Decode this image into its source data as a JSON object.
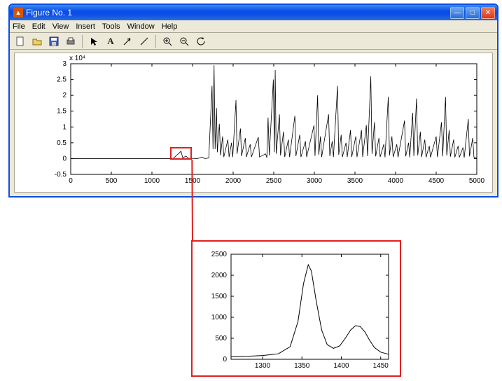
{
  "titlebar": {
    "title": "Figure No. 1"
  },
  "menu": {
    "file": "File",
    "edit": "Edit",
    "view": "View",
    "insert": "Insert",
    "tools": "Tools",
    "window": "Window",
    "help": "Help"
  },
  "toolbar": {
    "new": "□",
    "open": "📂",
    "save": "💾",
    "print": "🖨",
    "arrow": "↖",
    "textA": "A",
    "line": "╱",
    "zoomin": "⊕",
    "zoomout": "⊖",
    "rotate": "↻"
  },
  "chart_data": {
    "type": "line",
    "title": "",
    "xlabel": "",
    "ylabel": "",
    "exponent": "x 10⁴",
    "xlim": [
      0,
      5000
    ],
    "ylim": [
      -0.5,
      3
    ],
    "xticks": [
      0,
      500,
      1000,
      1500,
      2000,
      2500,
      3000,
      3500,
      4000,
      4500,
      5000
    ],
    "yticks": [
      -0.5,
      0,
      0.5,
      1,
      1.5,
      2,
      2.5,
      3
    ],
    "ytick_labels": [
      "-0.5",
      "0",
      "0.5",
      "1",
      "1.5",
      "2",
      "2.5",
      "3"
    ],
    "callout_region": {
      "xmin": 1250,
      "xmax": 1520,
      "ymin": -0.1,
      "ymax": 0.3
    },
    "inset": {
      "xlim": [
        1260,
        1460
      ],
      "ylim": [
        0,
        2500
      ],
      "xticks": [
        1300,
        1350,
        1400,
        1450
      ],
      "yticks": [
        0,
        500,
        1000,
        1500,
        2000,
        2500
      ],
      "xtick_labels": [
        "1300",
        "1350",
        "1400",
        "1450"
      ],
      "ytick_labels": [
        "0",
        "500",
        "1000",
        "1500",
        "2000",
        "2500"
      ],
      "series": [
        {
          "x": 1260,
          "y": 60
        },
        {
          "x": 1280,
          "y": 70
        },
        {
          "x": 1300,
          "y": 90
        },
        {
          "x": 1320,
          "y": 130
        },
        {
          "x": 1335,
          "y": 300
        },
        {
          "x": 1345,
          "y": 900
        },
        {
          "x": 1352,
          "y": 1800
        },
        {
          "x": 1358,
          "y": 2250
        },
        {
          "x": 1362,
          "y": 2100
        },
        {
          "x": 1368,
          "y": 1400
        },
        {
          "x": 1375,
          "y": 700
        },
        {
          "x": 1382,
          "y": 350
        },
        {
          "x": 1390,
          "y": 260
        },
        {
          "x": 1398,
          "y": 320
        },
        {
          "x": 1405,
          "y": 500
        },
        {
          "x": 1412,
          "y": 700
        },
        {
          "x": 1418,
          "y": 800
        },
        {
          "x": 1424,
          "y": 780
        },
        {
          "x": 1430,
          "y": 650
        },
        {
          "x": 1436,
          "y": 450
        },
        {
          "x": 1442,
          "y": 280
        },
        {
          "x": 1450,
          "y": 170
        },
        {
          "x": 1460,
          "y": 120
        }
      ]
    },
    "main_series": [
      {
        "x": 0,
        "y": 0.0
      },
      {
        "x": 1200,
        "y": 0.0
      },
      {
        "x": 1260,
        "y": 0.0
      },
      {
        "x": 1358,
        "y": 0.23
      },
      {
        "x": 1380,
        "y": 0.02
      },
      {
        "x": 1418,
        "y": 0.08
      },
      {
        "x": 1450,
        "y": 0.01
      },
      {
        "x": 1560,
        "y": 0.0
      },
      {
        "x": 1620,
        "y": 0.05
      },
      {
        "x": 1650,
        "y": 0.0
      },
      {
        "x": 1700,
        "y": 0.02
      },
      {
        "x": 1740,
        "y": 2.3
      },
      {
        "x": 1752,
        "y": 0.3
      },
      {
        "x": 1765,
        "y": 2.95
      },
      {
        "x": 1778,
        "y": 0.3
      },
      {
        "x": 1795,
        "y": 1.6
      },
      {
        "x": 1805,
        "y": 0.2
      },
      {
        "x": 1830,
        "y": 1.1
      },
      {
        "x": 1845,
        "y": 0.1
      },
      {
        "x": 1870,
        "y": 0.7
      },
      {
        "x": 1885,
        "y": 0.05
      },
      {
        "x": 1935,
        "y": 0.6
      },
      {
        "x": 1950,
        "y": 0.05
      },
      {
        "x": 1980,
        "y": 0.5
      },
      {
        "x": 1995,
        "y": 0.05
      },
      {
        "x": 2035,
        "y": 1.85
      },
      {
        "x": 2048,
        "y": 0.15
      },
      {
        "x": 2090,
        "y": 0.95
      },
      {
        "x": 2103,
        "y": 0.08
      },
      {
        "x": 2150,
        "y": 0.65
      },
      {
        "x": 2163,
        "y": 0.05
      },
      {
        "x": 2210,
        "y": 0.45
      },
      {
        "x": 2225,
        "y": 0.05
      },
      {
        "x": 2310,
        "y": 0.68
      },
      {
        "x": 2325,
        "y": 0.05
      },
      {
        "x": 2400,
        "y": 0.15
      },
      {
        "x": 2415,
        "y": 0.03
      },
      {
        "x": 2430,
        "y": 1.3
      },
      {
        "x": 2445,
        "y": 0.1
      },
      {
        "x": 2495,
        "y": 2.5
      },
      {
        "x": 2508,
        "y": 0.2
      },
      {
        "x": 2518,
        "y": 2.8
      },
      {
        "x": 2530,
        "y": 0.15
      },
      {
        "x": 2570,
        "y": 1.4
      },
      {
        "x": 2583,
        "y": 0.1
      },
      {
        "x": 2620,
        "y": 0.85
      },
      {
        "x": 2635,
        "y": 0.05
      },
      {
        "x": 2680,
        "y": 0.6
      },
      {
        "x": 2695,
        "y": 0.05
      },
      {
        "x": 2760,
        "y": 1.35
      },
      {
        "x": 2773,
        "y": 0.08
      },
      {
        "x": 2820,
        "y": 0.75
      },
      {
        "x": 2835,
        "y": 0.05
      },
      {
        "x": 2890,
        "y": 0.55
      },
      {
        "x": 2905,
        "y": 0.05
      },
      {
        "x": 2995,
        "y": 1.05
      },
      {
        "x": 3008,
        "y": 0.08
      },
      {
        "x": 3040,
        "y": 2.0
      },
      {
        "x": 3055,
        "y": 0.12
      },
      {
        "x": 3075,
        "y": 0.7
      },
      {
        "x": 3090,
        "y": 0.05
      },
      {
        "x": 3175,
        "y": 1.4
      },
      {
        "x": 3190,
        "y": 0.08
      },
      {
        "x": 3220,
        "y": 0.55
      },
      {
        "x": 3235,
        "y": 0.05
      },
      {
        "x": 3285,
        "y": 2.3
      },
      {
        "x": 3300,
        "y": 0.12
      },
      {
        "x": 3330,
        "y": 0.75
      },
      {
        "x": 3345,
        "y": 0.05
      },
      {
        "x": 3390,
        "y": 0.5
      },
      {
        "x": 3405,
        "y": 0.05
      },
      {
        "x": 3445,
        "y": 0.9
      },
      {
        "x": 3460,
        "y": 0.05
      },
      {
        "x": 3510,
        "y": 0.7
      },
      {
        "x": 3525,
        "y": 0.05
      },
      {
        "x": 3580,
        "y": 0.9
      },
      {
        "x": 3595,
        "y": 0.05
      },
      {
        "x": 3640,
        "y": 1.06
      },
      {
        "x": 3655,
        "y": 0.08
      },
      {
        "x": 3695,
        "y": 2.6
      },
      {
        "x": 3710,
        "y": 0.15
      },
      {
        "x": 3740,
        "y": 1.15
      },
      {
        "x": 3755,
        "y": 0.07
      },
      {
        "x": 3795,
        "y": 0.65
      },
      {
        "x": 3810,
        "y": 0.05
      },
      {
        "x": 3855,
        "y": 0.45
      },
      {
        "x": 3870,
        "y": 0.04
      },
      {
        "x": 3910,
        "y": 1.95
      },
      {
        "x": 3925,
        "y": 0.1
      },
      {
        "x": 3955,
        "y": 0.7
      },
      {
        "x": 3970,
        "y": 0.05
      },
      {
        "x": 4015,
        "y": 0.45
      },
      {
        "x": 4030,
        "y": 0.04
      },
      {
        "x": 4110,
        "y": 1.2
      },
      {
        "x": 4125,
        "y": 0.07
      },
      {
        "x": 4160,
        "y": 0.5
      },
      {
        "x": 4175,
        "y": 0.04
      },
      {
        "x": 4210,
        "y": 1.45
      },
      {
        "x": 4225,
        "y": 0.08
      },
      {
        "x": 4258,
        "y": 1.9
      },
      {
        "x": 4273,
        "y": 0.1
      },
      {
        "x": 4305,
        "y": 0.85
      },
      {
        "x": 4320,
        "y": 0.05
      },
      {
        "x": 4360,
        "y": 0.6
      },
      {
        "x": 4375,
        "y": 0.04
      },
      {
        "x": 4415,
        "y": 0.4
      },
      {
        "x": 4430,
        "y": 0.04
      },
      {
        "x": 4500,
        "y": 0.7
      },
      {
        "x": 4515,
        "y": 0.05
      },
      {
        "x": 4565,
        "y": 1.15
      },
      {
        "x": 4580,
        "y": 0.07
      },
      {
        "x": 4615,
        "y": 1.95
      },
      {
        "x": 4630,
        "y": 0.1
      },
      {
        "x": 4660,
        "y": 0.9
      },
      {
        "x": 4675,
        "y": 0.06
      },
      {
        "x": 4715,
        "y": 0.6
      },
      {
        "x": 4730,
        "y": 0.04
      },
      {
        "x": 4770,
        "y": 0.4
      },
      {
        "x": 4785,
        "y": 0.04
      },
      {
        "x": 4830,
        "y": 0.35
      },
      {
        "x": 4845,
        "y": 0.03
      },
      {
        "x": 4895,
        "y": 1.25
      },
      {
        "x": 4910,
        "y": 0.07
      },
      {
        "x": 4950,
        "y": 0.65
      },
      {
        "x": 4965,
        "y": 0.04
      },
      {
        "x": 5000,
        "y": 0.02
      }
    ]
  }
}
